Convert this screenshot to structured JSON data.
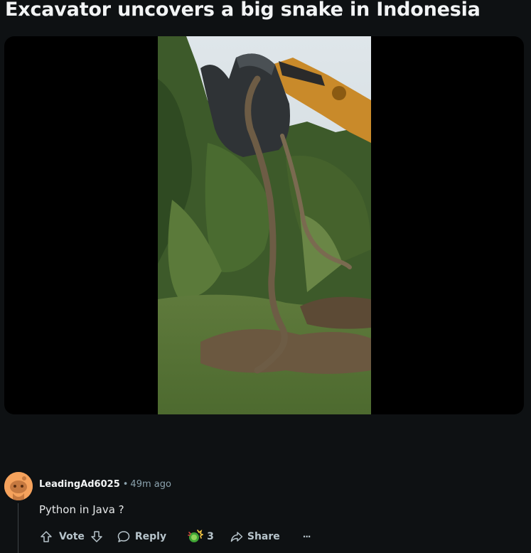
{
  "post": {
    "title": "Excavator uncovers a big snake in Indonesia"
  },
  "comment": {
    "author": "LeadingAd6025",
    "separator": "•",
    "time": "49m ago",
    "body": "Python in Java ?",
    "actions": {
      "vote_label": "Vote",
      "reply_label": "Reply",
      "award_count": "3",
      "share_label": "Share",
      "more_label": "···"
    }
  },
  "icons": {
    "upvote": "arrow-up-icon",
    "downvote": "arrow-down-icon",
    "reply": "speech-bubble-icon",
    "award": "award-icon",
    "share": "share-arrow-icon",
    "more": "ellipsis-icon"
  },
  "colors": {
    "background": "#0e1113",
    "media_background": "#000000",
    "avatar": "#f5a25c",
    "muted_text": "#8ba2ad"
  }
}
